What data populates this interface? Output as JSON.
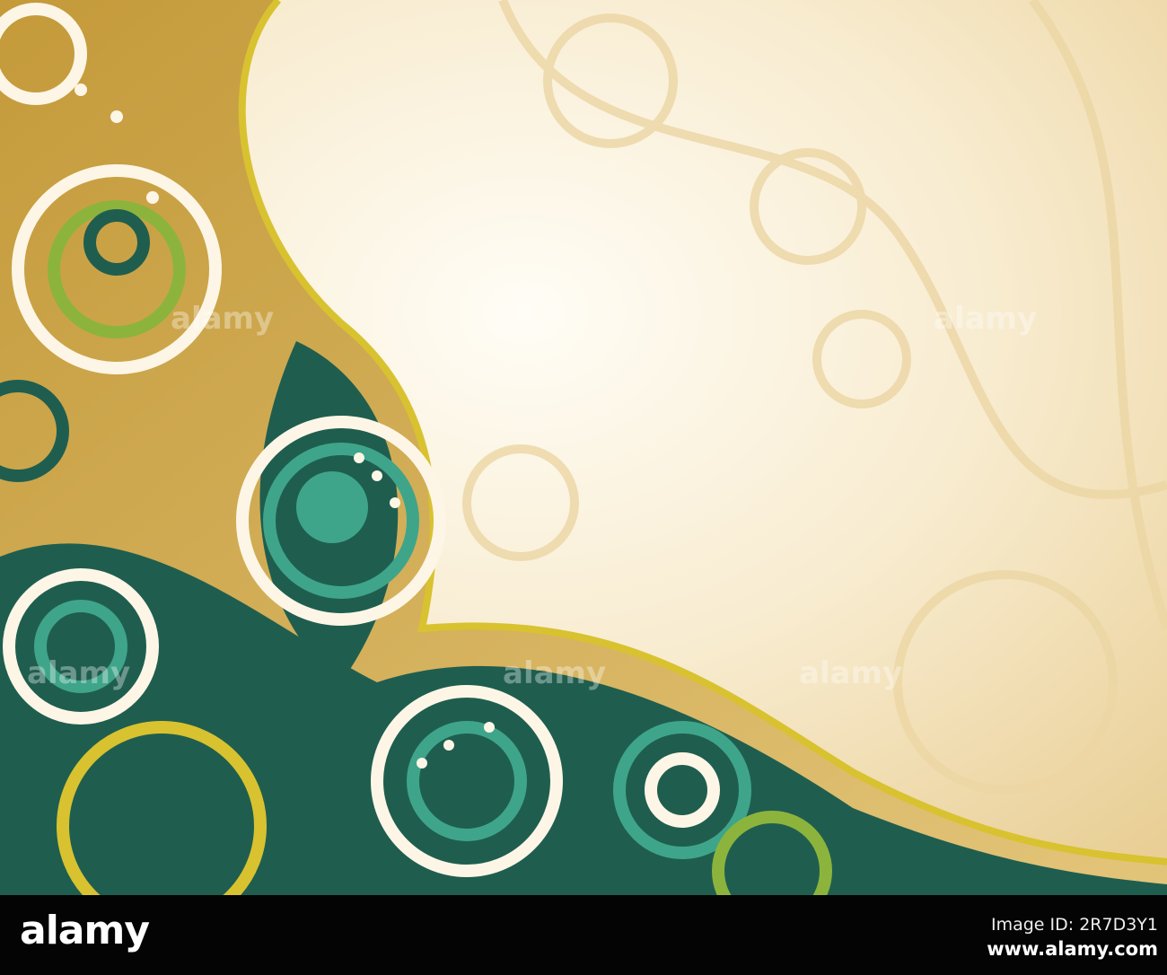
{
  "footer": {
    "logo": "alamy",
    "image_id": "Image ID: 2R7D3Y1",
    "website": "www.alamy.com"
  },
  "watermark": "alamy",
  "colors": {
    "cream": "#fdf6e6",
    "gold": "#d9b45a",
    "dark_teal": "#1f5e4f",
    "teal": "#3fa58a",
    "lime": "#8cb43c",
    "yellow_line": "#d8c230"
  }
}
